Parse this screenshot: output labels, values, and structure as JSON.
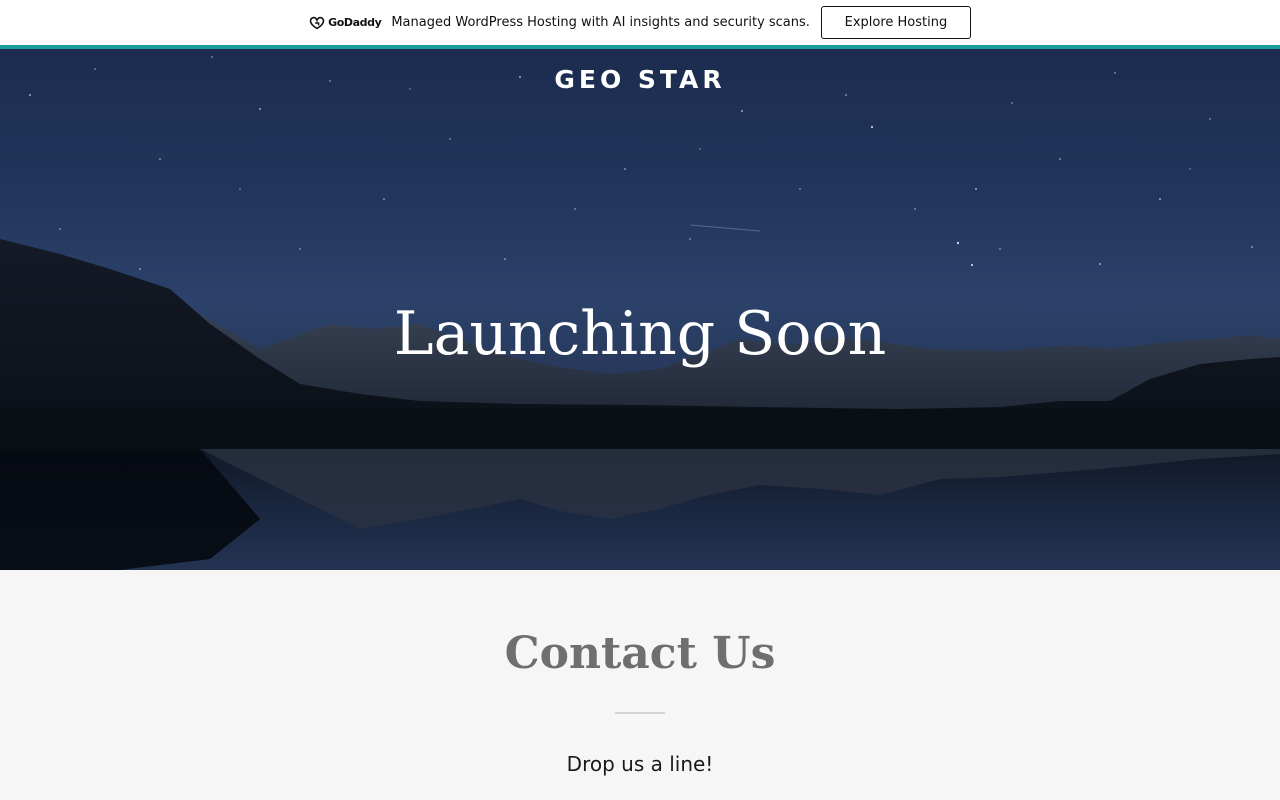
{
  "promo": {
    "logo_text": "GoDaddy",
    "message": "Managed WordPress Hosting with AI insights and security scans.",
    "button_label": "Explore Hosting"
  },
  "hero": {
    "brand": "GEO STAR",
    "title": "Launching Soon"
  },
  "contact": {
    "title": "Contact Us",
    "subtitle": "Drop us a line!"
  },
  "colors": {
    "accent": "#1c9e9e",
    "hero_sky": "#22375d",
    "section_bg": "#f6f6f6"
  }
}
